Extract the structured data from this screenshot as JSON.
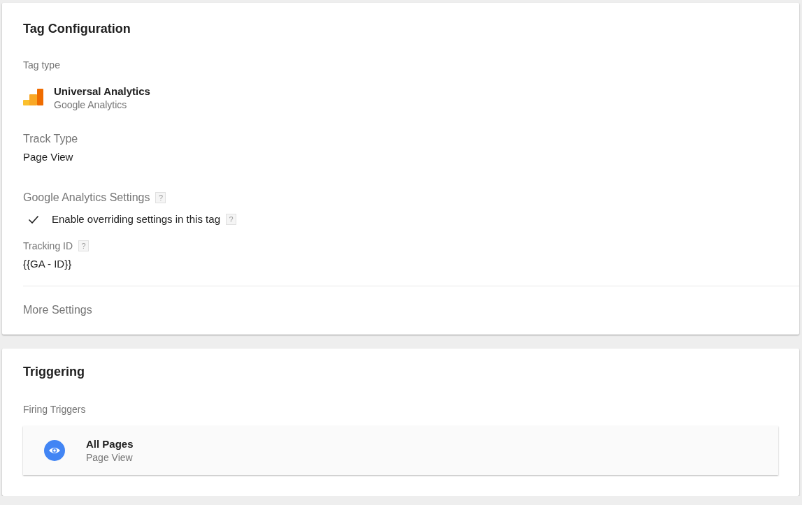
{
  "tag_configuration": {
    "title": "Tag Configuration",
    "tag_type_label": "Tag type",
    "tag_type": {
      "name": "Universal Analytics",
      "vendor": "Google Analytics"
    },
    "track_type": {
      "label": "Track Type",
      "value": "Page View"
    },
    "ga_settings": {
      "label": "Google Analytics Settings",
      "help": "?",
      "override": {
        "label": "Enable overriding settings in this tag",
        "checked": true,
        "help": "?"
      }
    },
    "tracking_id": {
      "label": "Tracking ID",
      "help": "?",
      "value": "{{GA - ID}}"
    },
    "more_settings": "More Settings"
  },
  "triggering": {
    "title": "Triggering",
    "firing_label": "Firing Triggers",
    "triggers": [
      {
        "name": "All Pages",
        "type": "Page View"
      }
    ]
  }
}
